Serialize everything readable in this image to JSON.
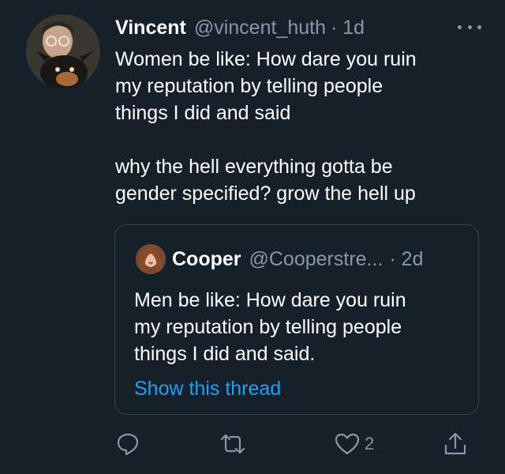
{
  "tweet": {
    "author_name": "Vincent",
    "author_handle": "@vincent_huth",
    "timestamp": "· 1d",
    "text": "Women be like: How dare you ruin\nmy reputation by telling people\nthings I did and said\n\nwhy the hell everything gotta be\ngender specified? grow the hell up"
  },
  "quoted_tweet": {
    "author_name": "Cooper",
    "author_handle": "@Cooperstre...",
    "timestamp": "· 2d",
    "text": "Men be like: How dare you ruin\nmy reputation by telling people\nthings I did and said.",
    "show_thread_label": "Show this thread"
  },
  "actions": {
    "reply_icon": "reply-icon",
    "retweet_icon": "retweet-icon",
    "like_icon": "heart-icon",
    "like_count": "2",
    "share_icon": "share-icon"
  },
  "colors": {
    "background": "#15202b",
    "text": "#ffffff",
    "secondary": "#8899a6",
    "link": "#1da1f2",
    "border": "#38444d"
  }
}
